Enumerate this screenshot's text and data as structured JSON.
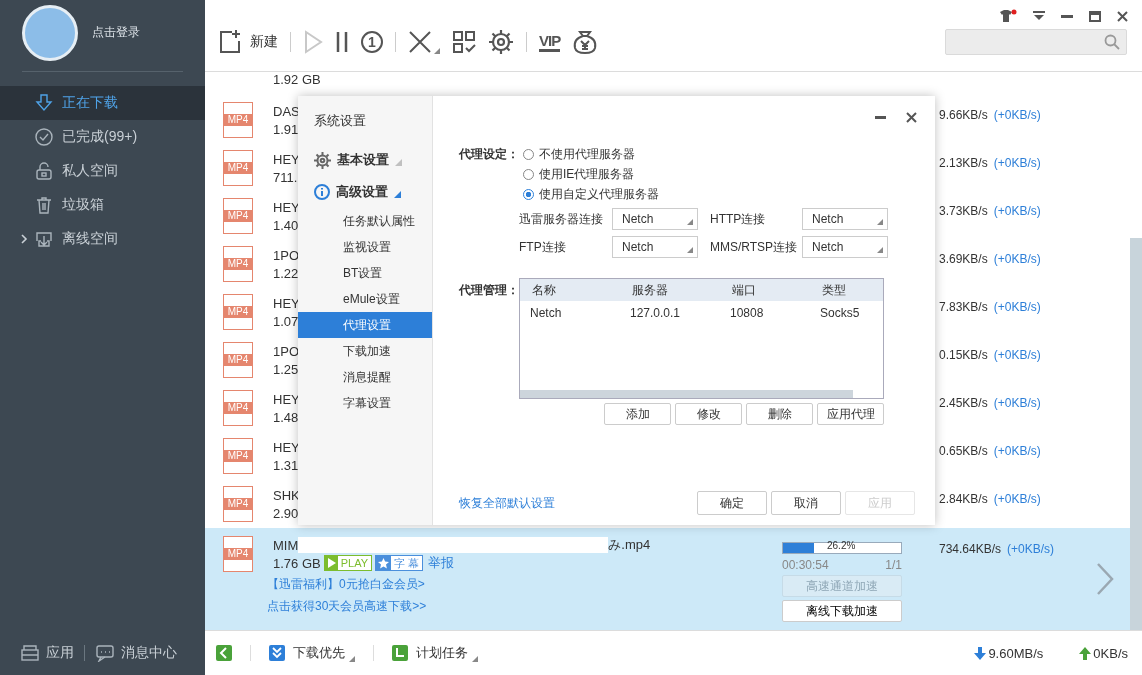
{
  "sidebar": {
    "login": "点击登录",
    "nav": [
      {
        "kind": "download",
        "label": "正在下载",
        "selected": true
      },
      {
        "kind": "check",
        "label": "已完成(99+)",
        "selected": false
      },
      {
        "kind": "lock",
        "label": "私人空间",
        "selected": false
      },
      {
        "kind": "trash",
        "label": "垃圾箱",
        "selected": false
      },
      {
        "kind": "offline",
        "label": "离线空间",
        "selected": false,
        "expanded": false
      }
    ],
    "footer": [
      {
        "kind": "apps",
        "label": "应用"
      },
      {
        "kind": "chat",
        "label": "消息中心"
      }
    ]
  },
  "toolbar": [
    [
      {
        "kind": "new",
        "label": "新建",
        "disabled": false
      }
    ],
    [
      {
        "kind": "play",
        "disabled": true
      },
      {
        "kind": "pause",
        "disabled": false
      },
      {
        "kind": "limit",
        "glyph": "1",
        "disabled": false
      }
    ],
    [
      {
        "kind": "delete",
        "disabled": false
      },
      {
        "kind": "grid",
        "disabled": false
      },
      {
        "kind": "gear",
        "disabled": false
      }
    ],
    [
      {
        "kind": "vip",
        "glyph": "VIP",
        "disabled": false
      },
      {
        "kind": "bag",
        "disabled": false
      }
    ]
  ],
  "downloads": [
    {
      "size": "1.92 GB",
      "selected": false
    },
    {
      "type": "MP4",
      "name": "DAS",
      "size": "1.91",
      "speed": "9.66KB/s",
      "extra": "(+0KB/s)",
      "selected": false
    },
    {
      "type": "MP4",
      "name": "HEY",
      "size": "711.",
      "speed": "2.13KB/s",
      "extra": "(+0KB/s)",
      "selected": false
    },
    {
      "type": "MP4",
      "name": "HEY",
      "size": "1.40",
      "speed": "3.73KB/s",
      "extra": "(+0KB/s)",
      "selected": false
    },
    {
      "type": "MP4",
      "name": "1PO",
      "size": "1.22",
      "speed": "3.69KB/s",
      "extra": "(+0KB/s)",
      "selected": false
    },
    {
      "type": "MP4",
      "name": "HEY",
      "size": "1.07",
      "speed": "7.83KB/s",
      "extra": "(+0KB/s)",
      "selected": false
    },
    {
      "type": "MP4",
      "name": "1PO",
      "size": "1.25",
      "speed": "0.15KB/s",
      "extra": "(+0KB/s)",
      "selected": false
    },
    {
      "type": "MP4",
      "name": "HEY",
      "size": "1.48",
      "speed": "2.45KB/s",
      "extra": "(+0KB/s)",
      "selected": false
    },
    {
      "type": "MP4",
      "name": "HEY",
      "size": "1.31",
      "speed": "0.65KB/s",
      "extra": "(+0KB/s)",
      "selected": false
    },
    {
      "type": "MP4",
      "name": "SHK",
      "size": "2.90",
      "speed": "2.84KB/s",
      "extra": "(+0KB/s)",
      "selected": false
    },
    {
      "type": "MP4",
      "name": "MIM",
      "name_end": "み.mp4",
      "size": "1.76 GB",
      "badges": [
        {
          "kind": "play",
          "label": "PLAY"
        },
        {
          "kind": "star",
          "label": "字 幕"
        }
      ],
      "report": "举报",
      "promos": [
        "【迅雷福利】0元抢白金会员>",
        "点击获得30天会员高速下载>>"
      ],
      "progress": {
        "level": 0.262,
        "label": "26.2%"
      },
      "time": "00:30:54",
      "count": "1/1",
      "actions": [
        {
          "label": "高速通道加速",
          "disabled": true
        },
        {
          "label": "离线下载加速",
          "disabled": false
        }
      ],
      "speed": "734.64KB/s",
      "extra": "(+0KB/s)",
      "selected": true
    }
  ],
  "bottom": {
    "items": [
      {
        "kind": "back"
      },
      {
        "kind": "priority",
        "label": "下载优先"
      },
      {
        "kind": "schedule",
        "label": "计划任务"
      }
    ],
    "down": "9.60MB/s",
    "up": "0KB/s"
  },
  "dialog": {
    "nav_title": "系统设置",
    "nav": [
      {
        "kind": "gear",
        "label": "基本设置",
        "expanded": false
      },
      {
        "kind": "info",
        "label": "高级设置",
        "expanded": true,
        "children": [
          {
            "label": "任务默认属性",
            "selected": false
          },
          {
            "label": "监视设置",
            "selected": false
          },
          {
            "label": "BT设置",
            "selected": false
          },
          {
            "label": "eMule设置",
            "selected": false
          },
          {
            "label": "代理设置",
            "selected": true
          },
          {
            "label": "下载加速",
            "selected": false
          },
          {
            "label": "消息提醒",
            "selected": false
          },
          {
            "label": "字幕设置",
            "selected": false
          }
        ]
      }
    ],
    "proxy_label": "代理设定：",
    "options": [
      {
        "label": "不使用代理服务器",
        "selected": false
      },
      {
        "label": "使用IE代理服务器",
        "selected": false
      },
      {
        "label": "使用自定义代理服务器",
        "selected": true
      }
    ],
    "connections": [
      {
        "label": "迅雷服务器连接",
        "value": "Netch"
      },
      {
        "label": "HTTP连接",
        "value": "Netch"
      },
      {
        "label": "FTP连接",
        "value": "Netch"
      },
      {
        "label": "MMS/RTSP连接",
        "value": "Netch"
      }
    ],
    "manage_label": "代理管理：",
    "table": {
      "columns": [
        "名称",
        "服务器",
        "端口",
        "类型"
      ],
      "rows": [
        [
          "Netch",
          "127.0.0.1",
          "10808",
          "Socks5"
        ]
      ]
    },
    "table_buttons": [
      "添加",
      "修改",
      "删除",
      "应用代理"
    ],
    "restore_link": "恢复全部默认设置",
    "buttons": [
      {
        "label": "确定",
        "disabled": false
      },
      {
        "label": "取消",
        "disabled": false
      },
      {
        "label": "应用",
        "disabled": true
      }
    ]
  }
}
